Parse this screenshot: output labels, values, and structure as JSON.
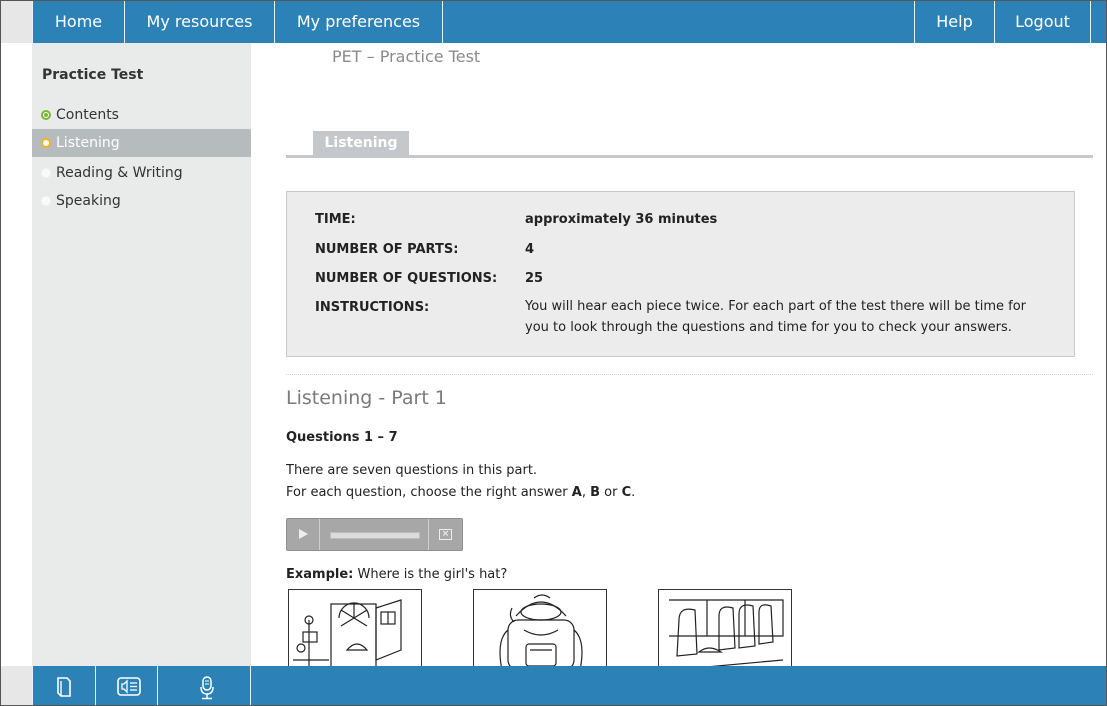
{
  "nav": {
    "home": "Home",
    "my_resources": "My resources",
    "my_preferences": "My preferences",
    "help": "Help",
    "logout": "Logout"
  },
  "sidebar": {
    "title": "Practice Test",
    "items": [
      {
        "label": "Contents",
        "status": "visited"
      },
      {
        "label": "Listening",
        "status": "current"
      },
      {
        "label": "Reading & Writing",
        "status": "unvisited"
      },
      {
        "label": "Speaking",
        "status": "unvisited"
      }
    ]
  },
  "main": {
    "doc_title": "PET – Practice Test",
    "tab_label": "Listening",
    "info": {
      "time_label": "TIME:",
      "time_value": "approximately 36 minutes",
      "parts_label": "NUMBER OF PARTS:",
      "parts_value": "4",
      "questions_label": "NUMBER OF QUESTIONS:",
      "questions_value": "25",
      "instructions_label": "INSTRUCTIONS:",
      "instructions_value": "You will hear each piece twice. For each part of the test there will be time for you to look through the questions and time for you to check your answers."
    },
    "part_title": "Listening - Part 1",
    "question_range": "Questions 1 – 7",
    "intro_line1": "There are seven questions in this part.",
    "intro_line2_prefix": "For each question, choose the right answer ",
    "intro_a": "A",
    "intro_sep1": ", ",
    "intro_b": "B",
    "intro_sep2": " or ",
    "intro_c": "C",
    "intro_end": ".",
    "example_label": "Example:",
    "example_question": " Where is the girl's hat?",
    "player": {
      "play_icon": "play-icon",
      "volume_icon": "volume-icon"
    }
  },
  "bottombar": {
    "icons": [
      "book-icon",
      "audio-script-icon",
      "microphone-icon"
    ]
  },
  "colors": {
    "brand_blue": "#2c81b7",
    "sidebar_bg": "#e9ebeb",
    "active_item": "#b6bbbe",
    "visited_dot": "#7cb82f",
    "current_dot": "#f2b51e"
  }
}
